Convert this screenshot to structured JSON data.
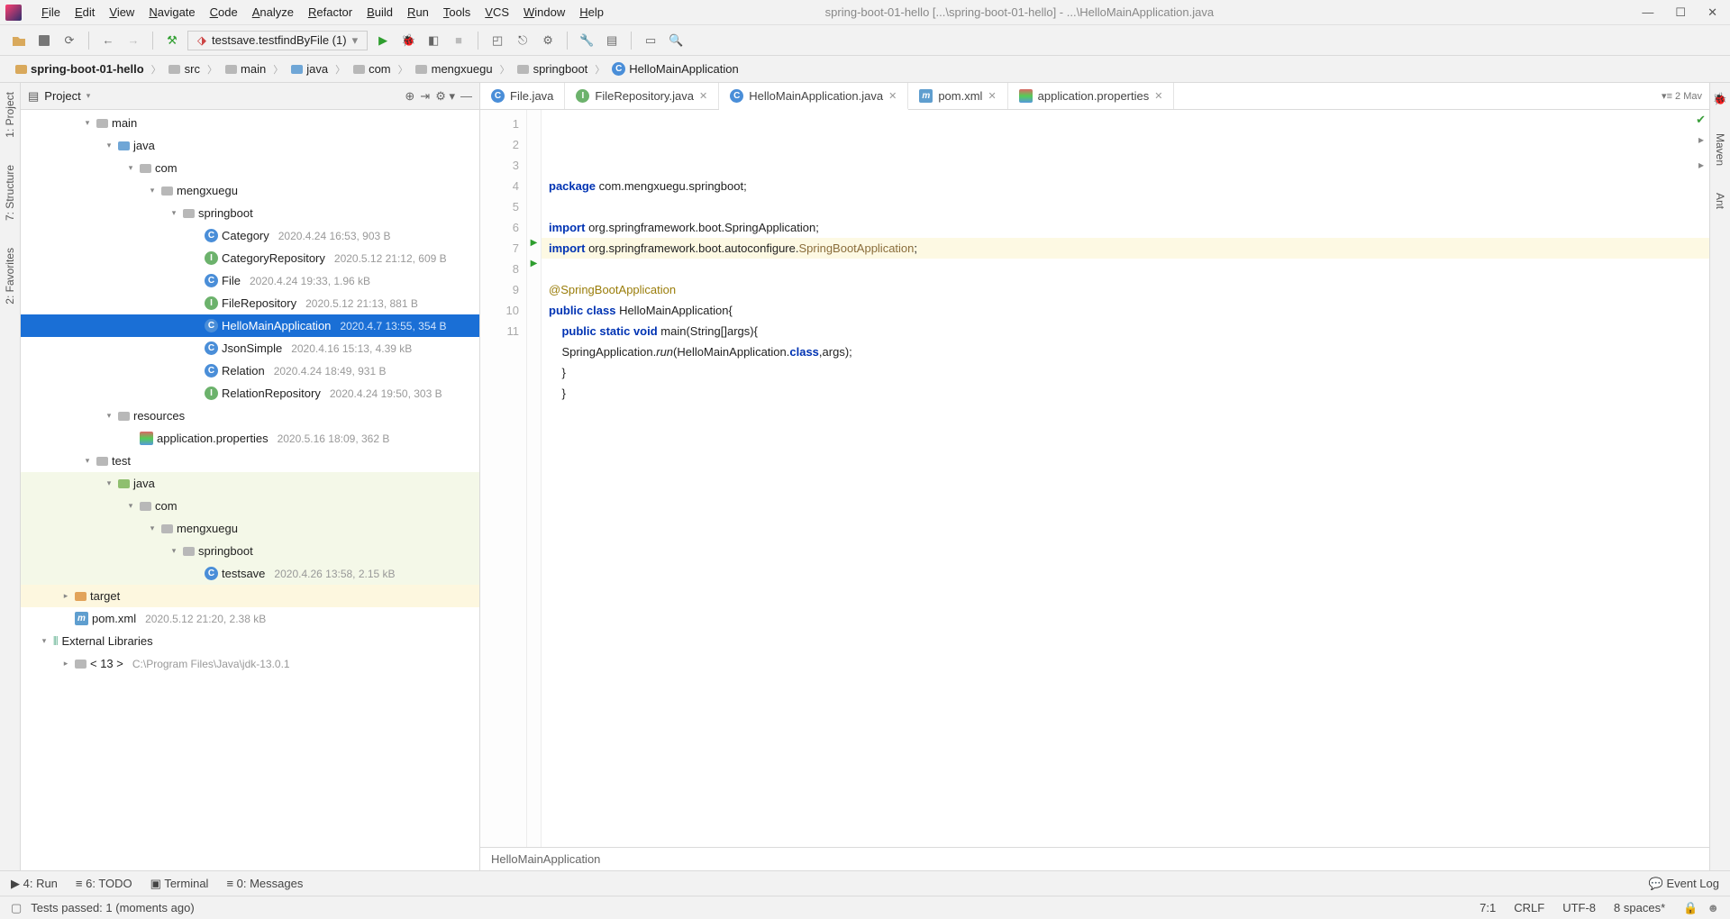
{
  "window_title": "spring-boot-01-hello [...\\spring-boot-01-hello] - ...\\HelloMainApplication.java",
  "menu": [
    "File",
    "Edit",
    "View",
    "Navigate",
    "Code",
    "Analyze",
    "Refactor",
    "Build",
    "Run",
    "Tools",
    "VCS",
    "Window",
    "Help"
  ],
  "run_config": "testsave.testfindByFile (1)",
  "breadcrumbs": [
    "spring-boot-01-hello",
    "src",
    "main",
    "java",
    "com",
    "mengxuegu",
    "springboot",
    "HelloMainApplication"
  ],
  "sidebar_title": "Project",
  "left_tabs": [
    "1: Project",
    "7: Structure",
    "2: Favorites"
  ],
  "right_tabs": [
    "Maven",
    "Ant"
  ],
  "tabs_extra_label": "▾≡ 2   Mav",
  "tree": [
    {
      "indent": 2,
      "arrow": "▾",
      "icon": "folder-gray",
      "label": "main"
    },
    {
      "indent": 3,
      "arrow": "▾",
      "icon": "folder-blue",
      "label": "java"
    },
    {
      "indent": 4,
      "arrow": "▾",
      "icon": "folder-gray",
      "label": "com"
    },
    {
      "indent": 5,
      "arrow": "▾",
      "icon": "folder-gray",
      "label": "mengxuegu"
    },
    {
      "indent": 6,
      "arrow": "▾",
      "icon": "folder-gray",
      "label": "springboot"
    },
    {
      "indent": 7,
      "arrow": "",
      "icon": "c",
      "label": "Category",
      "meta": "2020.4.24 16:53, 903 B"
    },
    {
      "indent": 7,
      "arrow": "",
      "icon": "i",
      "label": "CategoryRepository",
      "meta": "2020.5.12 21:12, 609 B"
    },
    {
      "indent": 7,
      "arrow": "",
      "icon": "c",
      "label": "File",
      "meta": "2020.4.24 19:33, 1.96 kB"
    },
    {
      "indent": 7,
      "arrow": "",
      "icon": "i",
      "label": "FileRepository",
      "meta": "2020.5.12 21:13, 881 B"
    },
    {
      "indent": 7,
      "arrow": "",
      "icon": "c",
      "label": "HelloMainApplication",
      "meta": "2020.4.7 13:55, 354 B",
      "sel": true
    },
    {
      "indent": 7,
      "arrow": "",
      "icon": "c",
      "label": "JsonSimple",
      "meta": "2020.4.16 15:13, 4.39 kB"
    },
    {
      "indent": 7,
      "arrow": "",
      "icon": "c",
      "label": "Relation",
      "meta": "2020.4.24 18:49, 931 B"
    },
    {
      "indent": 7,
      "arrow": "",
      "icon": "i",
      "label": "RelationRepository",
      "meta": "2020.4.24 19:50, 303 B"
    },
    {
      "indent": 3,
      "arrow": "▾",
      "icon": "folder-gray",
      "label": "resources"
    },
    {
      "indent": 4,
      "arrow": "",
      "icon": "props",
      "label": "application.properties",
      "meta": "2020.5.16 18:09, 362 B"
    },
    {
      "indent": 2,
      "arrow": "▾",
      "icon": "folder-gray",
      "label": "test"
    },
    {
      "indent": 3,
      "arrow": "▾",
      "icon": "folder-green",
      "label": "java",
      "tint": true
    },
    {
      "indent": 4,
      "arrow": "▾",
      "icon": "folder-gray",
      "label": "com",
      "tint": true
    },
    {
      "indent": 5,
      "arrow": "▾",
      "icon": "folder-gray",
      "label": "mengxuegu",
      "tint": true
    },
    {
      "indent": 6,
      "arrow": "▾",
      "icon": "folder-gray",
      "label": "springboot",
      "tint": true
    },
    {
      "indent": 7,
      "arrow": "",
      "icon": "c",
      "label": "testsave",
      "meta": "2020.4.26 13:58, 2.15 kB",
      "tint": true
    },
    {
      "indent": 1,
      "arrow": "▸",
      "icon": "folder-orange",
      "label": "target",
      "target": true
    },
    {
      "indent": 1,
      "arrow": "",
      "icon": "m",
      "label": "pom.xml",
      "meta": "2020.5.12 21:20, 2.38 kB"
    },
    {
      "indent": 0,
      "arrow": "▾",
      "icon": "libs",
      "label": "External Libraries"
    },
    {
      "indent": 1,
      "arrow": "▸",
      "icon": "folder-gray",
      "label": "< 13 >",
      "meta": "C:\\Program Files\\Java\\jdk-13.0.1"
    }
  ],
  "tabs": [
    {
      "icon": "c",
      "label": "File.java"
    },
    {
      "icon": "i",
      "label": "FileRepository.java",
      "close": true
    },
    {
      "icon": "c",
      "label": "HelloMainApplication.java",
      "close": true,
      "active": true
    },
    {
      "icon": "m",
      "label": "pom.xml",
      "close": true
    },
    {
      "icon": "props",
      "label": "application.properties",
      "close": true
    }
  ],
  "code_lines": [
    "1",
    "2",
    "3",
    "4",
    "5",
    "6",
    "7",
    "8",
    "9",
    "10",
    "11"
  ],
  "run_marks": {
    "7": true,
    "8": true
  },
  "code_html": [
    "<span class='kw'>package</span> com.mengxuegu.springboot;",
    "",
    "<span class='kw'>import</span> org.springframework.boot.SpringApplication;",
    "<span class='kw'>import</span> org.springframework.boot.autoconfigure.<span class='cls'>SpringBootApplication</span>;",
    "",
    "<span class='ann'>@SpringBootApplication</span>",
    "<span class='kw'>public</span> <span class='kw'>class</span> HelloMainApplication{",
    "    <span class='kw'>public</span> <span class='kw'>static</span> <span class='kw'>void</span> main(String[]args){",
    "    SpringApplication.<span class='fn-it'>run</span>(HelloMainApplication.<span class='kw'>class</span>,args);",
    "    }",
    "    }"
  ],
  "editor_foot": "HelloMainApplication",
  "bottom_tools": [
    "▶ 4: Run",
    "≡ 6: TODO",
    "▣ Terminal",
    "≡ 0: Messages"
  ],
  "event_log": "Event Log",
  "status_msg": "Tests passed: 1 (moments ago)",
  "status_right": [
    "7:1",
    "CRLF",
    "UTF-8",
    "8 spaces*"
  ]
}
